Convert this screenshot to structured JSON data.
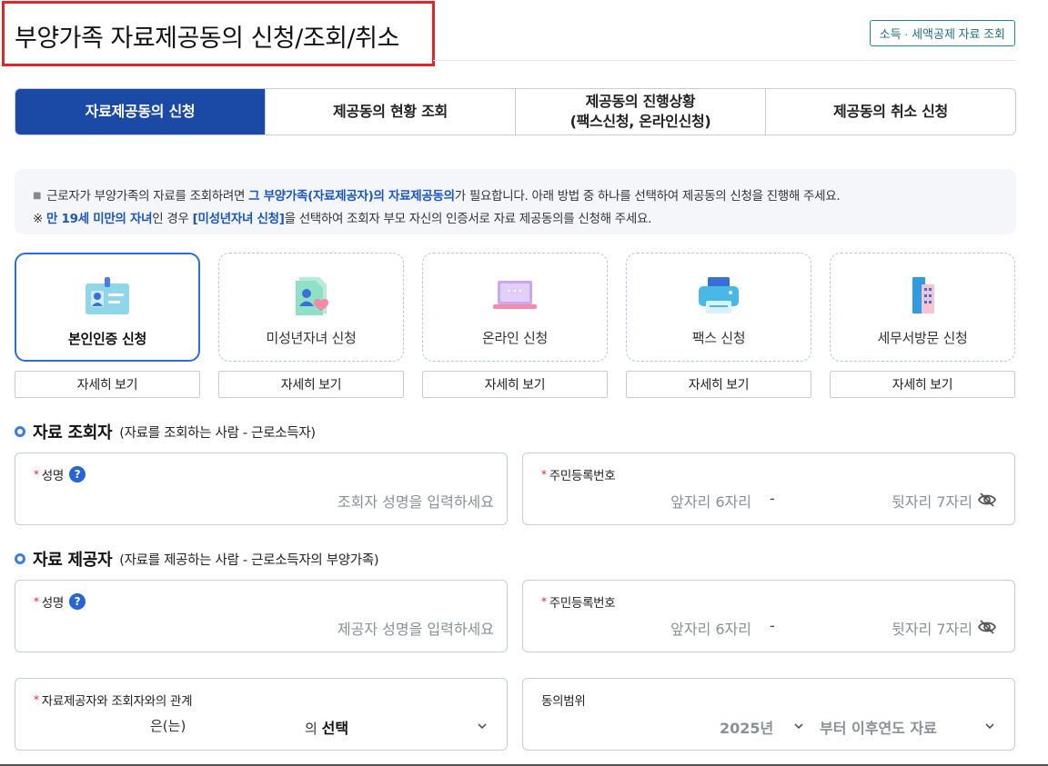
{
  "header": {
    "title": "부양가족 자료제공동의 신청/조회/취소",
    "link_button": "소득 · 세액공제 자료 조회"
  },
  "tabs": [
    {
      "label": "자료제공동의 신청",
      "active": true
    },
    {
      "label": "제공동의 현황 조회",
      "active": false
    },
    {
      "label": "제공동의 진행상황\n(팩스신청, 온라인신청)",
      "active": false
    },
    {
      "label": "제공동의 취소 신청",
      "active": false
    }
  ],
  "notice": {
    "line1_a": "근로자가 부양가족의 자료를 조회하려면 ",
    "line1_hl": "그 부양가족(자료제공자)의 자료제공동의",
    "line1_b": "가 필요합니다. 아래 방법 중 하나를 선택하여 제공동의 신청을 진행해 주세요.",
    "line2_mark": "※ ",
    "line2_hl1": "만 19세 미만의 자녀",
    "line2_a": "인 경우 ",
    "line2_hl2": "[미성년자녀 신청]",
    "line2_b": "을 선택하여 조회자 부모 자신의 인증서로 자료 제공동의를 신청해 주세요."
  },
  "methods": [
    {
      "label": "본인인증 신청",
      "icon": "id-card-icon",
      "active": true
    },
    {
      "label": "미성년자녀 신청",
      "icon": "child-document-icon",
      "active": false
    },
    {
      "label": "온라인 신청",
      "icon": "laptop-icon",
      "active": false
    },
    {
      "label": "팩스 신청",
      "icon": "fax-icon",
      "active": false
    },
    {
      "label": "세무서방문 신청",
      "icon": "building-icon",
      "active": false
    }
  ],
  "detail_button_label": "자세히 보기",
  "viewer_section": {
    "title": "자료 조회자",
    "subtitle": "(자료를 조회하는 사람 - 근로소득자)",
    "name_label": "성명",
    "name_placeholder": "조회자 성명을 입력하세요",
    "rrn_label": "주민등록번호",
    "rrn_front_placeholder": "앞자리 6자리",
    "rrn_sep": "-",
    "rrn_back_placeholder": "뒷자리 7자리"
  },
  "provider_section": {
    "title": "자료 제공자",
    "subtitle": "(자료를 제공하는 사람 - 근로소득자의 부양가족)",
    "name_label": "성명",
    "name_placeholder": "제공자 성명을 입력하세요",
    "rrn_label": "주민등록번호",
    "rrn_front_placeholder": "앞자리 6자리",
    "rrn_sep": "-",
    "rrn_back_placeholder": "뒷자리 7자리"
  },
  "relation": {
    "label": "자료제공자와 조회자와의 관계",
    "part1": "은(는)",
    "part2": "의",
    "selected": "선택"
  },
  "consent_range": {
    "label": "동의범위",
    "year": "2025년",
    "suffix": "부터 이후연도 자료"
  },
  "help_glyph": "?",
  "colors": {
    "primary": "#1b4aa6",
    "accent_blue": "#2a6fd6",
    "highlight_text": "#1b57c4",
    "required": "#e0262b",
    "teal_button": "#1d8a9a"
  }
}
